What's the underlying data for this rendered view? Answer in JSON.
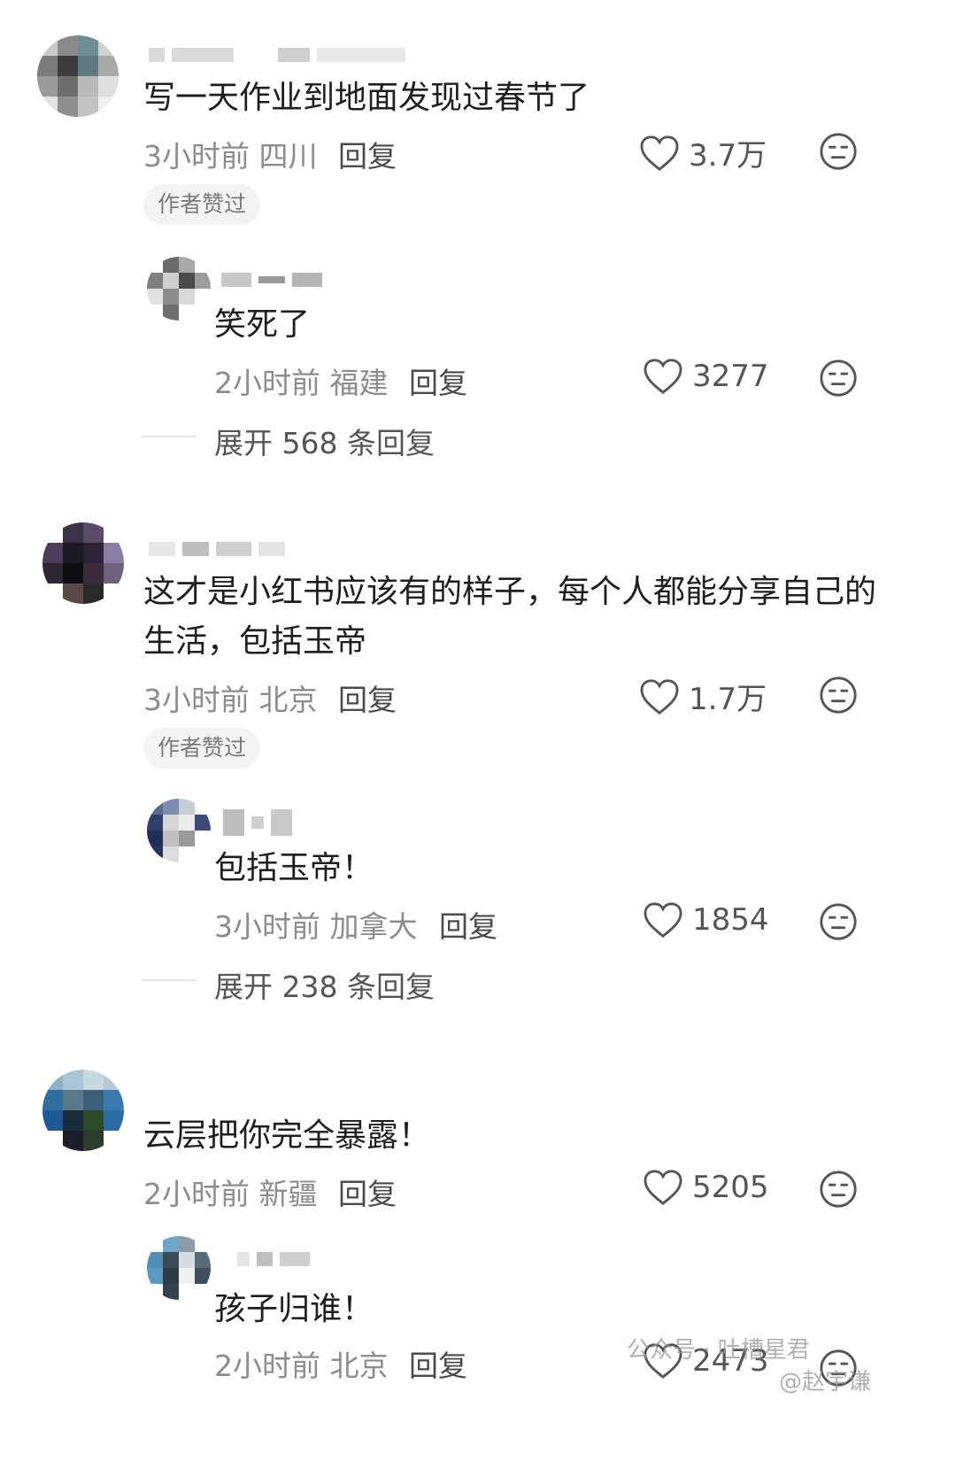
{
  "comments": [
    {
      "text": "写一天作业到地面发现过春节了",
      "time": "3小时前",
      "location": "四川",
      "reply_label": "回复",
      "likes": "3.7万",
      "badge": "作者赞过",
      "sub_reply": {
        "text": "笑死了",
        "time": "2小时前",
        "location": "福建",
        "reply_label": "回复",
        "likes": "3277"
      },
      "expand_label": "展开 568 条回复"
    },
    {
      "text_line1": "这才是小红书应该有的样子，每个人都能分享自己的",
      "text_line2": "生活，包括玉帝",
      "time": "3小时前",
      "location": "北京",
      "reply_label": "回复",
      "likes": "1.7万",
      "badge": "作者赞过",
      "sub_reply": {
        "text": "包括玉帝！",
        "time": "3小时前",
        "location": "加拿大",
        "reply_label": "回复",
        "likes": "1854"
      },
      "expand_label": "展开 238 条回复"
    },
    {
      "text": "云层把你完全暴露！",
      "time": "2小时前",
      "location": "新疆",
      "reply_label": "回复",
      "likes": "5205",
      "sub_reply": {
        "text": "孩子归谁！",
        "time": "2小时前",
        "location": "北京",
        "reply_label": "回复",
        "likes": "2473"
      }
    }
  ],
  "watermark": {
    "wechat": "公众号 · 吐槽星君",
    "weibo": "@赵宇谦"
  },
  "icons": {
    "like": "heart-outline-icon",
    "dislike": "neutral-face-icon"
  },
  "colors": {
    "text": "#1e1e1e",
    "meta": "#8c8c8c",
    "icon": "#555555"
  }
}
